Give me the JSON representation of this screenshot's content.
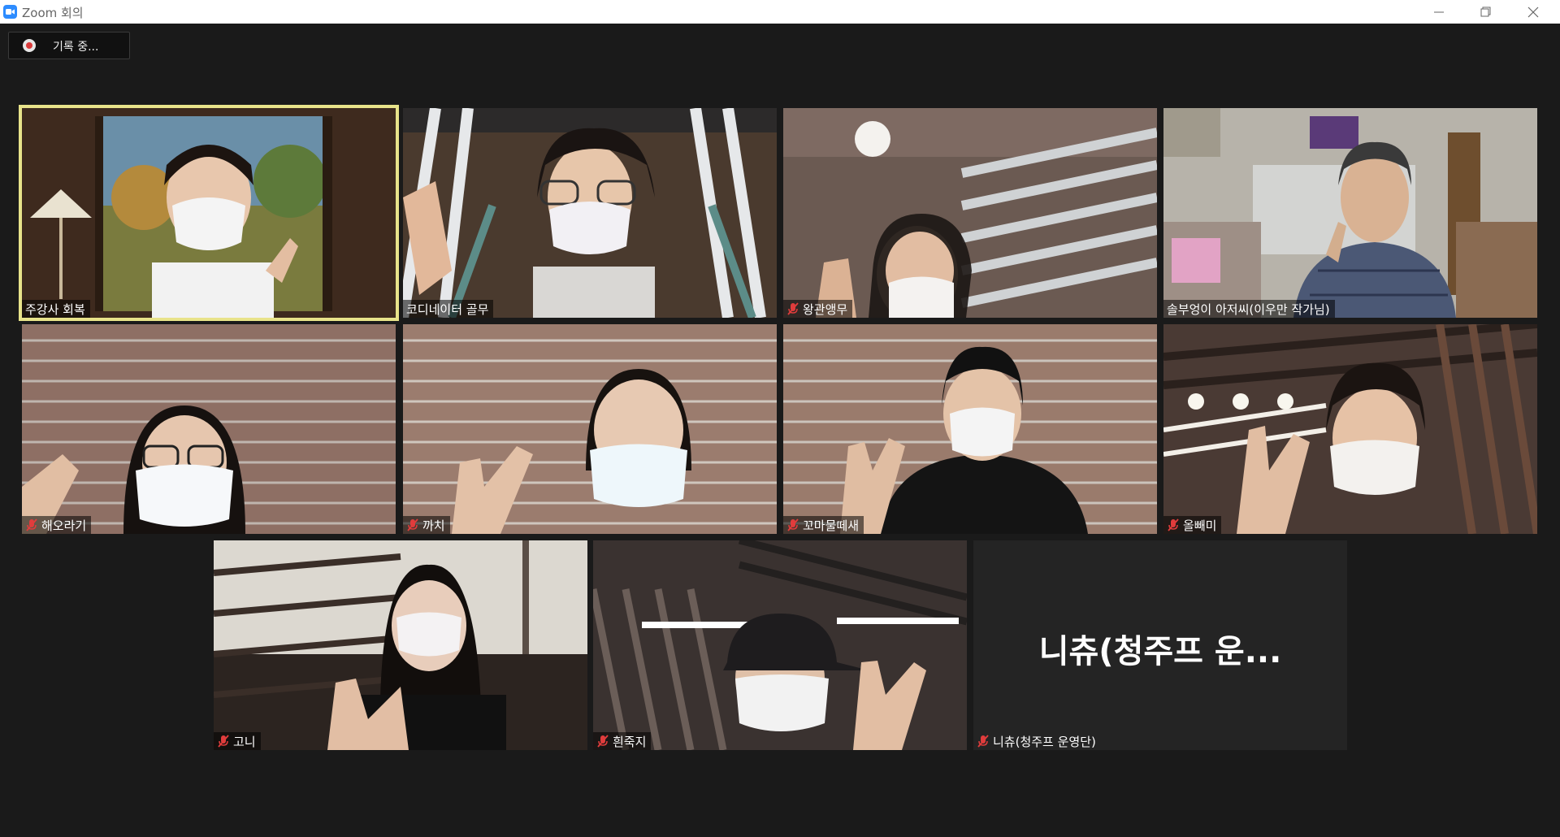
{
  "window": {
    "title": "Zoom 회의",
    "icon": "zoom-camera-icon"
  },
  "recording": {
    "label": "기록 중..."
  },
  "colors": {
    "active_speaker_border": "#e8e38a",
    "mute_icon": "#e03c3c",
    "background": "#1a1a1a"
  },
  "participants": [
    {
      "name": "주강사 회복",
      "muted": false,
      "active": true
    },
    {
      "name": "코디네이터 골무",
      "muted": false,
      "active": false
    },
    {
      "name": "왕관앵무",
      "muted": true,
      "active": false
    },
    {
      "name": "솔부엉이 아저씨(이우만 작가님)",
      "muted": false,
      "active": false
    },
    {
      "name": "해오라기",
      "muted": true,
      "active": false
    },
    {
      "name": "까치",
      "muted": true,
      "active": false
    },
    {
      "name": "꼬마물떼새",
      "muted": true,
      "active": false
    },
    {
      "name": "올빼미",
      "muted": true,
      "active": false
    },
    {
      "name": "고니",
      "muted": true,
      "active": false
    },
    {
      "name": "흰죽지",
      "muted": true,
      "active": false
    },
    {
      "name": "니츄(청주프 운영단)",
      "muted": true,
      "active": false,
      "video_off": true,
      "display_name": "니츄(청주프 운..."
    }
  ]
}
